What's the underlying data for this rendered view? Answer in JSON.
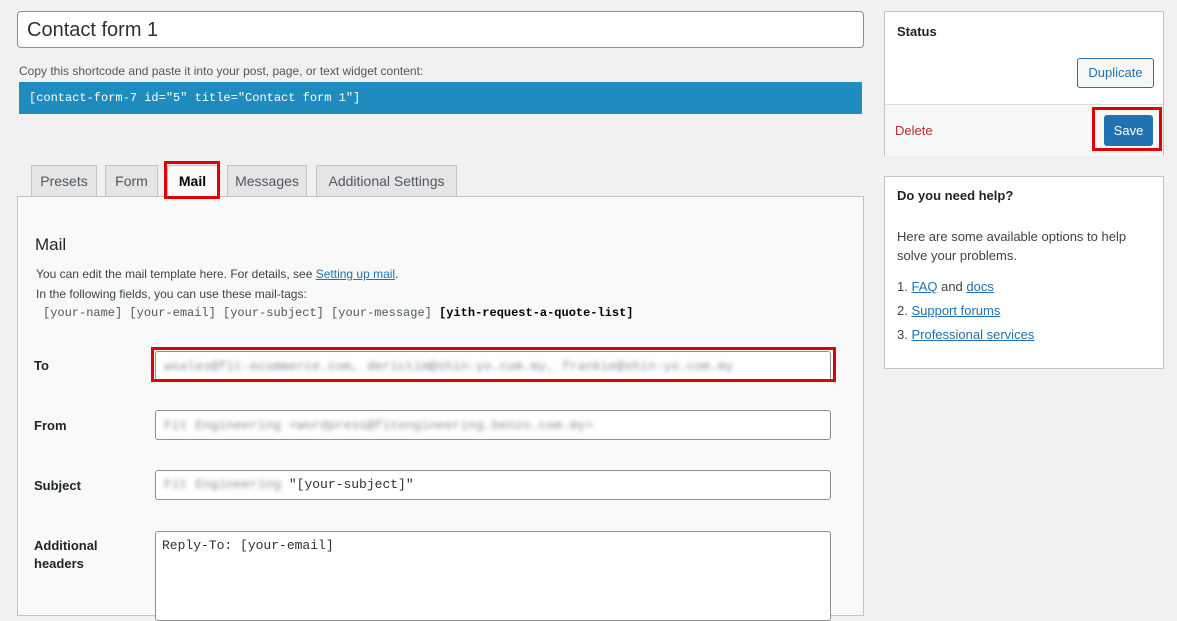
{
  "title": {
    "value": "Contact form 1"
  },
  "shortcode": {
    "label": "Copy this shortcode and paste it into your post, page, or text widget content:",
    "code": "[contact-form-7 id=\"5\" title=\"Contact form 1\"]"
  },
  "tabs": [
    {
      "label": "Presets"
    },
    {
      "label": "Form"
    },
    {
      "label": "Mail"
    },
    {
      "label": "Messages"
    },
    {
      "label": "Additional Settings"
    }
  ],
  "mail": {
    "heading": "Mail",
    "desc_prefix": "You can edit the mail template here. For details, see ",
    "desc_link": "Setting up mail",
    "desc_suffix": ".",
    "tags_intro": "In the following fields, you can use these mail-tags:",
    "tags": "[your-name] [your-email] [your-subject] [your-message]",
    "tags_bold": "[yith-request-a-quote-list]",
    "fields": {
      "to_label": "To",
      "to_value": "wsales@fit-ecommerce.com, derictim@shin-yo.com.my, frankie@shin-yo.com.my",
      "from_label": "From",
      "from_value": "Fit Engineering <wordpress@fitengineering.benzo.com.my>",
      "subject_label": "Subject",
      "subject_prefix": "Fit Engineering",
      "subject_value": "\"[your-subject]\"",
      "headers_label_1": "Additional",
      "headers_label_2": "headers",
      "headers_value": "Reply-To: [your-email]"
    }
  },
  "status_box": {
    "title": "Status",
    "duplicate": "Duplicate",
    "delete": "Delete",
    "save": "Save"
  },
  "help_box": {
    "title": "Do you need help?",
    "text": "Here are some available options to help solve your problems.",
    "item1_num": "1.",
    "item1_link1": "FAQ",
    "item1_and": " and ",
    "item1_link2": "docs",
    "item2_num": "2.",
    "item2_link": "Support forums",
    "item3_num": "3.",
    "item3_link": "Professional services"
  },
  "colors": {
    "accent": "#2271b1",
    "highlight": "#e00000",
    "delete": "#b32d2e"
  }
}
